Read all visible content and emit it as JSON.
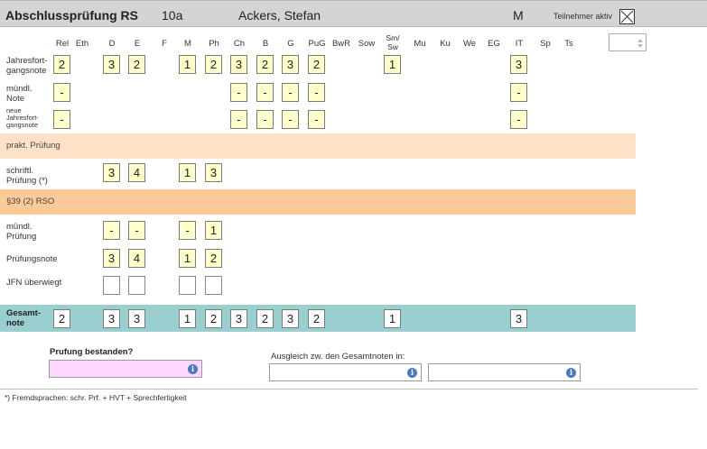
{
  "header": {
    "title": "Abschlussprüfung RS",
    "class": "10a",
    "student": "Ackers, Stefan",
    "gender": "M",
    "active_label": "Teilnehmer aktiv",
    "active_checked": true
  },
  "subjects": [
    "Rel",
    "Eth",
    "D",
    "E",
    "F",
    "M",
    "Ph",
    "Ch",
    "B",
    "G",
    "PuG",
    "BwR",
    "Sow",
    "Sm/ Sw",
    "Mu",
    "Ku",
    "We",
    "EG",
    "IT",
    "Sp",
    "Ts"
  ],
  "subjects_2line": {
    "top": "Sm/",
    "bottom": "Sw"
  },
  "rows": {
    "jahresfortgangsnote": {
      "label_1": "Jahresfort-",
      "label_2": "gangsnote",
      "values": [
        "2",
        "",
        "3",
        "2",
        "",
        "1",
        "2",
        "3",
        "2",
        "3",
        "2",
        "",
        "",
        "1",
        "",
        "",
        "",
        "",
        "3",
        "",
        ""
      ]
    },
    "muendl_note": {
      "label_1": "mündl.",
      "label_2": "Note",
      "values": [
        "-",
        "",
        "",
        "",
        "",
        "",
        "",
        "-",
        "-",
        "-",
        "-",
        "",
        "",
        "",
        "",
        "",
        "",
        "",
        "-",
        "",
        ""
      ]
    },
    "neue_jfn": {
      "label_1": "neue",
      "label_2": "Jahresfort-",
      "label_3": "gangsnote",
      "values": [
        "-",
        "",
        "",
        "",
        "",
        "",
        "",
        "-",
        "-",
        "-",
        "-",
        "",
        "",
        "",
        "",
        "",
        "",
        "",
        "-",
        "",
        ""
      ]
    },
    "schriftl_pruefung": {
      "label_1": "schriftl.",
      "label_2": "Prüfung (*)",
      "values": [
        "",
        "",
        "3",
        "4",
        "",
        "1",
        "3"
      ]
    },
    "muendl_pruefung": {
      "label_1": "mündl.",
      "label_2": "Prüfung",
      "values": [
        "",
        "",
        "-",
        "-",
        "",
        "-",
        "1"
      ]
    },
    "pruefungsnote": {
      "label": "Prüfungsnote",
      "values": [
        "",
        "",
        "3",
        "4",
        "",
        "1",
        "2"
      ]
    },
    "jfn_ueberwiegt": {
      "label": "JFN überwiegt",
      "values": [
        "",
        "",
        "",
        "",
        "",
        "",
        ""
      ]
    },
    "gesamtnote": {
      "label_1": "Gesamt-",
      "label_2": "note",
      "values": [
        "2",
        "",
        "3",
        "3",
        "",
        "1",
        "2",
        "3",
        "2",
        "3",
        "2",
        "",
        "",
        "1",
        "",
        "",
        "",
        "",
        "3",
        "",
        ""
      ]
    }
  },
  "bands": {
    "prakt": "prakt. Prüfung",
    "rso": "§39 (2) RSO"
  },
  "bottom": {
    "pruefung_label": "Prufung bestanden?",
    "ausgleich_label": "Ausgleich zw. den Gesamtnoten in:",
    "info_glyph": "i"
  },
  "footnote": "*) Fremdsprachen: schr. Prf. + HVT + Sprechfertigkeit",
  "colors": {
    "header_bg": "#d4d4d4",
    "cell_bg": "#ffffcc",
    "prakt_bg": "#fde2c8",
    "rso_bg": "#fcc999",
    "gesamt_bg": "#9acfcf",
    "pruef_field_bg": "#ffd6ff",
    "info_icon": "#4a7ac4"
  }
}
